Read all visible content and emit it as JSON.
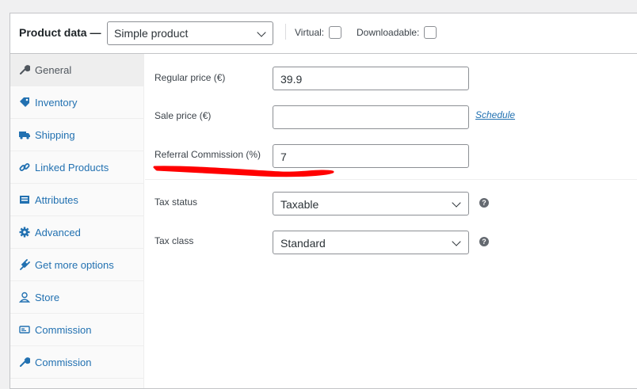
{
  "header": {
    "title": "Product data —",
    "product_type": "Simple product",
    "virtual_label": "Virtual:",
    "downloadable_label": "Downloadable:"
  },
  "tabs": [
    {
      "label": "General",
      "icon": "wrench-icon",
      "active": true
    },
    {
      "label": "Inventory",
      "icon": "tag-icon",
      "active": false
    },
    {
      "label": "Shipping",
      "icon": "truck-icon",
      "active": false
    },
    {
      "label": "Linked Products",
      "icon": "link-icon",
      "active": false
    },
    {
      "label": "Attributes",
      "icon": "list-icon",
      "active": false
    },
    {
      "label": "Advanced",
      "icon": "gear-icon",
      "active": false
    },
    {
      "label": "Get more options",
      "icon": "plugin-icon",
      "active": false
    },
    {
      "label": "Store",
      "icon": "user-icon",
      "active": false
    },
    {
      "label": "Commission",
      "icon": "card-icon",
      "active": false
    },
    {
      "label": "Commission",
      "icon": "wrench-icon",
      "active": false
    }
  ],
  "fields": {
    "regular_price": {
      "label": "Regular price (€)",
      "value": "39.9"
    },
    "sale_price": {
      "label": "Sale price (€)",
      "value": "",
      "link": "Schedule"
    },
    "referral": {
      "label": "Referral Commission (%)",
      "value": "7"
    },
    "tax_status": {
      "label": "Tax status",
      "value": "Taxable"
    },
    "tax_class": {
      "label": "Tax class",
      "value": "Standard"
    }
  },
  "colors": {
    "link": "#2271b1",
    "annotation": "#ff0000"
  }
}
